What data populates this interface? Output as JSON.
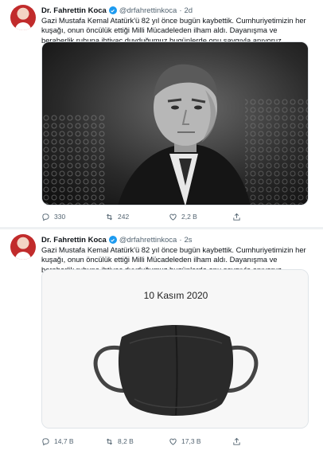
{
  "tweets": [
    {
      "author": {
        "name": "Dr. Fahrettin Koca",
        "handle": "@drfahrettinkoca",
        "verified": true
      },
      "time": "2d",
      "text": "Gazi Mustafa Kemal Atatürk'ü 82 yıl önce bugün kaybettik. Cumhuriyetimizin her kuşağı, onun öncülük ettiği Milli Mücadeleden ilham aldı. Dayanışma ve beraberlik ruhuna ihtiyaç duyduğumuz bugünlerde onu saygıyla anıyoruz.",
      "media": {
        "kind": "black-and-white portrait photograph"
      },
      "actions": {
        "replies": "330",
        "retweets": "242",
        "likes": "2,2 B"
      }
    },
    {
      "author": {
        "name": "Dr. Fahrettin Koca",
        "handle": "@drfahrettinkoca",
        "verified": true
      },
      "time": "2s",
      "text": "Gazi Mustafa Kemal Atatürk'ü 82 yıl önce bugün kaybettik. Cumhuriyetimizin her kuşağı, onun öncülük ettiği Milli Mücadeleden ilham aldı. Dayanışma ve beraberlik ruhuna ihtiyaç duyduğumuz bugünlerde onu saygıyla anıyoruz.",
      "media": {
        "kind": "black face mask illustration",
        "caption": "10 Kasım 2020"
      },
      "actions": {
        "replies": "14,7 B",
        "retweets": "8,2 B",
        "likes": "17,3 B"
      }
    }
  ],
  "colors": {
    "verified": "#1d9bf0",
    "muted": "#536471",
    "text": "#0f1419"
  },
  "icons": [
    "reply-icon",
    "retweet-icon",
    "like-icon",
    "share-icon",
    "verified-icon"
  ]
}
